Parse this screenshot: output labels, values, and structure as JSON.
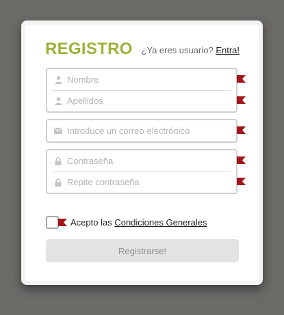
{
  "form": {
    "title": "REGISTRO",
    "login_prompt_text": "¿Ya eres usuario?",
    "login_link": "Entra!",
    "fields": {
      "first_name": {
        "placeholder": "Nombre",
        "icon": "user-icon",
        "value": ""
      },
      "last_name": {
        "placeholder": "Apellidos",
        "icon": "user-icon",
        "value": ""
      },
      "email": {
        "placeholder": "Introduce un correo electrónico",
        "icon": "envelope-icon",
        "value": ""
      },
      "password": {
        "placeholder": "Contraseña",
        "icon": "lock-icon",
        "value": ""
      },
      "password_confirm": {
        "placeholder": "Repite contraseña",
        "icon": "lock-icon",
        "value": ""
      }
    },
    "terms": {
      "prefix": "Acepto las",
      "link": "Condiciones Generales",
      "checked": false
    },
    "submit_label": "Registrarse!"
  },
  "colors": {
    "page_background": "#6b6a67",
    "title": "#9bb43a",
    "required_flag": "#a3141b",
    "button_bg": "#e3e3e3",
    "button_text": "#8e8e8e"
  }
}
